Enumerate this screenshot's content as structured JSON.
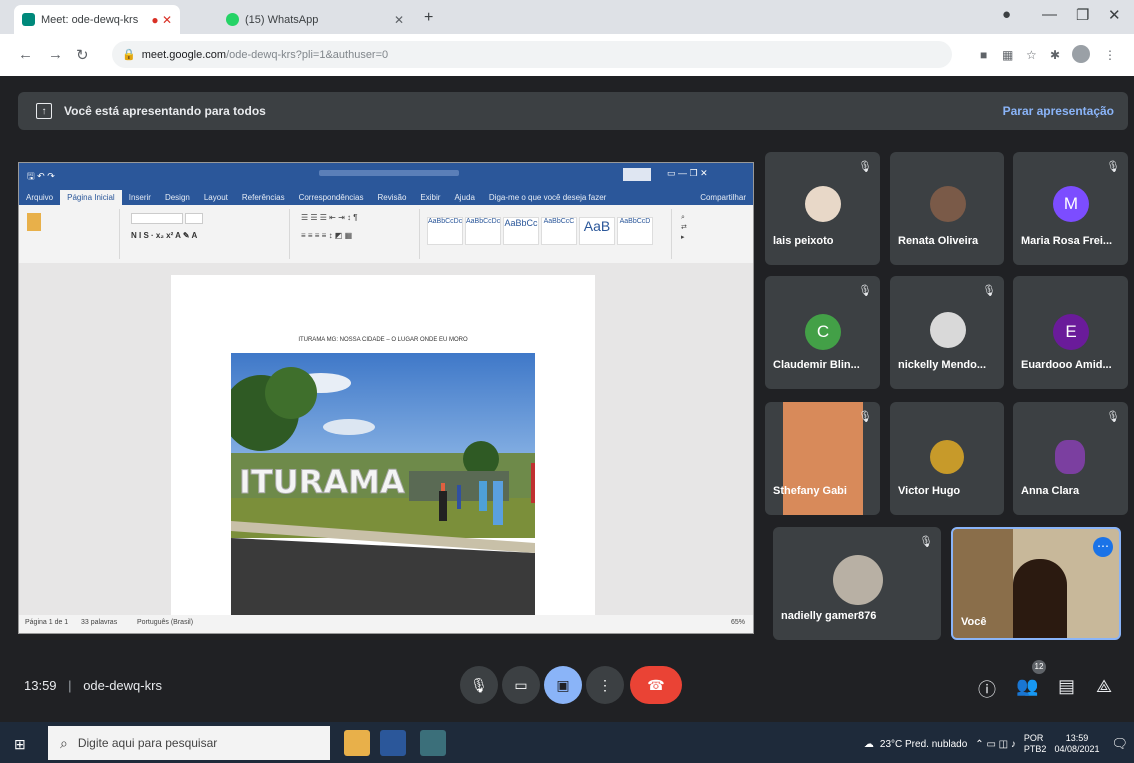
{
  "browser": {
    "tabs": [
      {
        "label": "Meet: ode-dewq-krs",
        "active": true
      },
      {
        "label": "(15) WhatsApp",
        "active": false
      }
    ],
    "url_host": "meet.google.com",
    "url_path": "/ode-dewq-krs?pli=1&authuser=0"
  },
  "presentation": {
    "banner_text": "Você está apresentando para todos",
    "stop_label": "Parar apresentação"
  },
  "word": {
    "menu": [
      "Arquivo",
      "Página Inicial",
      "Inserir",
      "Design",
      "Layout",
      "Referências",
      "Correspondências",
      "Revisão",
      "Exibir",
      "Ajuda"
    ],
    "search_placeholder": "Diga-me o que você deseja fazer",
    "share_label": "Compartilhar",
    "styles": [
      "AaBbCcDc",
      "AaBbCcDc",
      "AaBbCc",
      "AaBbCcC",
      "AaB",
      "AaBbCcD"
    ],
    "document_caption": "ITURAMA MG: NOSSA CIDADE – O LUGAR ONDE EU MORO",
    "status_left": "Página 1 de 1",
    "status_words": "33 palavras",
    "status_lang": "Português (Brasil)",
    "zoom": "65%",
    "photo_sign": "ITURAMA"
  },
  "participants": [
    {
      "name": "lais peixoto",
      "muted": true,
      "avatar": "photo",
      "color": "#e8d8c8"
    },
    {
      "name": "Renata Oliveira",
      "muted": false,
      "avatar": "photo",
      "color": "#7a5a48"
    },
    {
      "name": "Maria Rosa Frei...",
      "muted": true,
      "avatar": "M",
      "color": "#7c4dff"
    },
    {
      "name": "Claudemir Blin...",
      "muted": true,
      "avatar": "C",
      "color": "#43a047"
    },
    {
      "name": "nickelly Mendo...",
      "muted": true,
      "avatar": "photo",
      "color": "#d9d9d9"
    },
    {
      "name": "Euardooo Amid...",
      "muted": false,
      "avatar": "E",
      "color": "#6a1b9a"
    },
    {
      "name": "Sthefany Gabi",
      "muted": true,
      "avatar": "photo",
      "color": "#e6a070"
    },
    {
      "name": "Victor Hugo",
      "muted": false,
      "avatar": "photo",
      "color": "#c79a2a"
    },
    {
      "name": "Anna Clara",
      "muted": true,
      "avatar": "photo",
      "color": "#7b3fa0"
    },
    {
      "name": "nadielly gamer876",
      "muted": true,
      "avatar": "photo",
      "color": "#b8b0a4"
    },
    {
      "name": "Você",
      "muted": false,
      "avatar": "video",
      "color": "#2b1a10"
    }
  ],
  "meeting": {
    "time": "13:59",
    "code": "ode-dewq-krs",
    "people_badge": "12"
  },
  "taskbar": {
    "search_placeholder": "Digite aqui para pesquisar",
    "weather": "23°C  Pred. nublado",
    "lang": "POR",
    "lang2": "PTB2",
    "time": "13:59",
    "date": "04/08/2021"
  }
}
